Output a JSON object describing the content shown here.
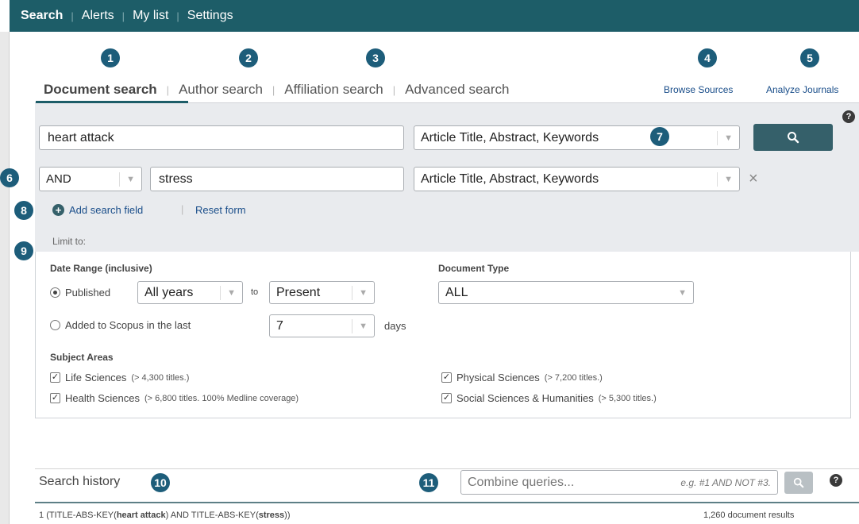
{
  "topnav": {
    "items": [
      "Search",
      "Alerts",
      "My list",
      "Settings"
    ]
  },
  "badges": [
    "1",
    "2",
    "3",
    "4",
    "5",
    "6",
    "7",
    "8",
    "9",
    "10",
    "11"
  ],
  "tabs": {
    "document": "Document search",
    "author": "Author search",
    "affiliation": "Affiliation search",
    "advanced": "Advanced search",
    "browse_sources": "Browse Sources",
    "analyze_journals": "Analyze Journals"
  },
  "search": {
    "field1_value": "heart attack",
    "field1_scope": "Article Title, Abstract, Keywords",
    "operator": "AND",
    "field2_value": "stress",
    "field2_scope": "Article Title, Abstract, Keywords",
    "add_field": "Add search field",
    "reset_form": "Reset form",
    "remove_symbol": "×",
    "help_symbol": "?"
  },
  "limit": {
    "label": "Limit to:",
    "date_range_label": "Date Range (inclusive)",
    "published_label": "Published",
    "from_value": "All years",
    "to_label": "to",
    "to_value": "Present",
    "added_label": "Added to Scopus in the last",
    "days_value": "7",
    "days_label": "days",
    "doc_type_label": "Document Type",
    "doc_type_value": "ALL",
    "subject_areas_label": "Subject Areas",
    "subjects": [
      {
        "name": "Life Sciences",
        "note": "(> 4,300 titles.)"
      },
      {
        "name": "Health Sciences",
        "note": "(> 6,800 titles. 100% Medline coverage)"
      },
      {
        "name": "Physical Sciences",
        "note": "(> 7,200 titles.)"
      },
      {
        "name": "Social Sciences & Humanities",
        "note": "(> 5,300 titles.)"
      }
    ]
  },
  "history": {
    "title": "Search history",
    "combine_placeholder": "Combine queries...",
    "combine_hint": "e.g. #1 AND NOT #3.",
    "row1_prefix": "1",
    "row1_query_a": "(TITLE-ABS-KEY(",
    "row1_term_a": "heart attack",
    "row1_query_b": ") AND TITLE-ABS-KEY(",
    "row1_term_b": "stress",
    "row1_query_c": "))",
    "row1_results": "1,260 document results"
  },
  "colors": {
    "topbar": "#1d5d68",
    "badge": "#1d5d7a",
    "link": "#1a4e8a",
    "search_button": "#35606a",
    "panel": "#e9ebee"
  }
}
